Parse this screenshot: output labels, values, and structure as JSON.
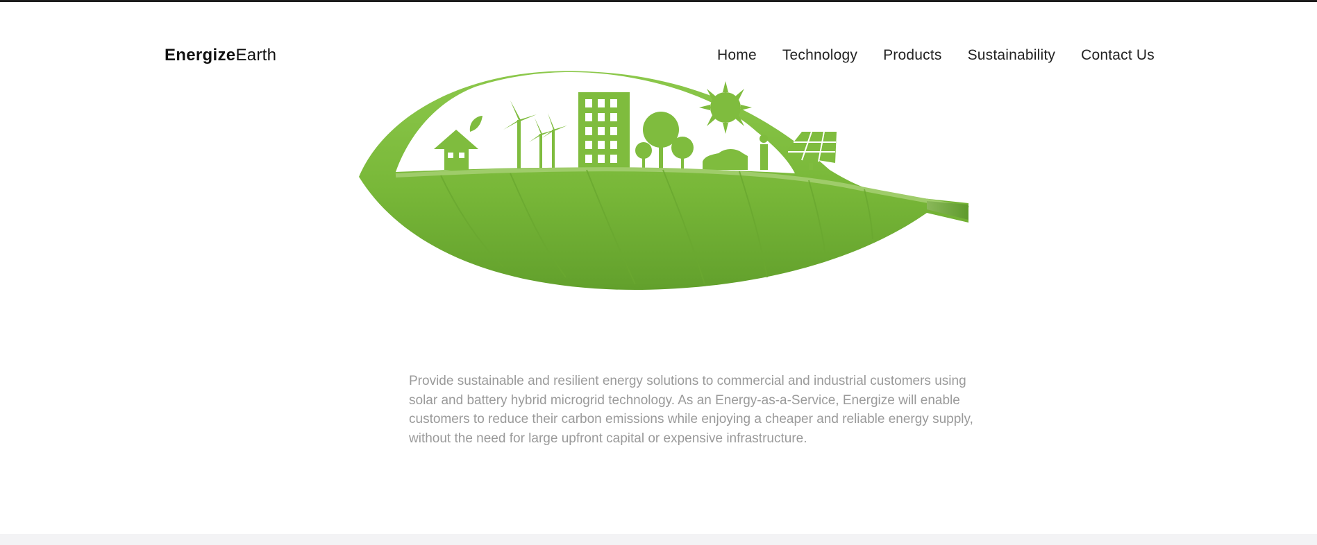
{
  "brand": {
    "name_bold": "Energize",
    "name_light": "Earth"
  },
  "nav": {
    "items": [
      {
        "label": "Home"
      },
      {
        "label": "Technology"
      },
      {
        "label": "Products"
      },
      {
        "label": "Sustainability"
      },
      {
        "label": "Contact Us"
      }
    ]
  },
  "hero": {
    "image": "leaf-with-city-cutout-image"
  },
  "mission": {
    "text": "Provide sustainable and resilient energy solutions to commercial and industrial customers using solar and battery hybrid microgrid technology. As an Energy-as-a-Service, Energize will enable customers to reduce their carbon emissions while enjoying a cheaper and reliable energy supply, without the need for large upfront capital or expensive infrastructure."
  },
  "colors": {
    "leaf_green": "#7cbd3a",
    "leaf_dark": "#5c9a28",
    "text_muted": "#9a9a9a",
    "text_dark": "#111111"
  }
}
